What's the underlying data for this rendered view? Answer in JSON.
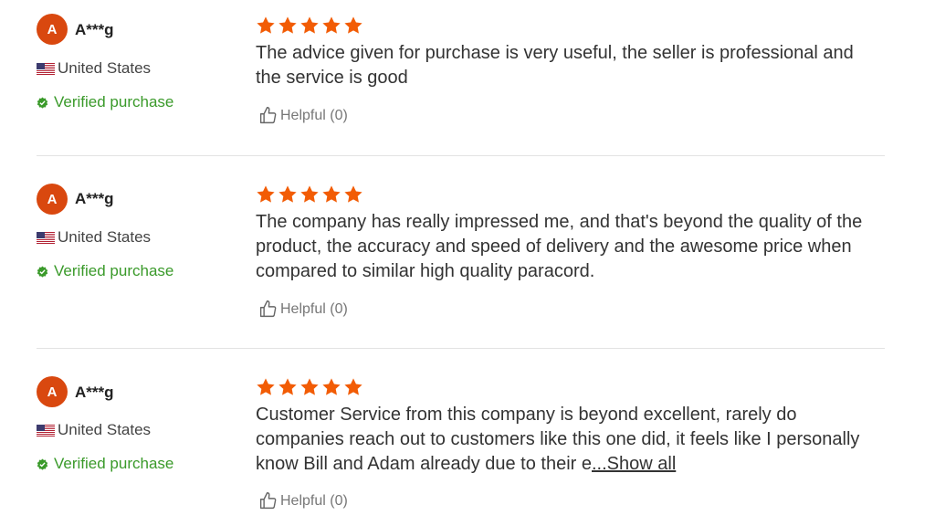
{
  "colors": {
    "star": "#f25c05",
    "avatar_bg": "#d9480f",
    "verified": "#3a9a2a",
    "helpful": "#777777"
  },
  "reviews": [
    {
      "avatar_initial": "A",
      "username": "A***g",
      "country": "United States",
      "country_flag_icon": "us-flag-icon",
      "verified_label": "Verified purchase",
      "rating": 5,
      "text": "The advice given for purchase is very useful, the seller is professional and the service is good",
      "show_all": "",
      "helpful_label": "Helpful (0)"
    },
    {
      "avatar_initial": "A",
      "username": "A***g",
      "country": "United States",
      "country_flag_icon": "us-flag-icon",
      "verified_label": "Verified purchase",
      "rating": 5,
      "text": "The company has really impressed me, and that's beyond the quality of the product, the accuracy and speed of delivery and the awesome price when compared to similar high quality paracord.",
      "show_all": "",
      "helpful_label": "Helpful (0)"
    },
    {
      "avatar_initial": "A",
      "username": "A***g",
      "country": "United States",
      "country_flag_icon": "us-flag-icon",
      "verified_label": "Verified purchase",
      "rating": 5,
      "text": "Customer Service from this company is beyond excellent, rarely do companies reach out to customers like this one did, it feels like I personally know Bill and Adam already due to their e",
      "show_all": "...Show all",
      "helpful_label": "Helpful (0)"
    }
  ]
}
